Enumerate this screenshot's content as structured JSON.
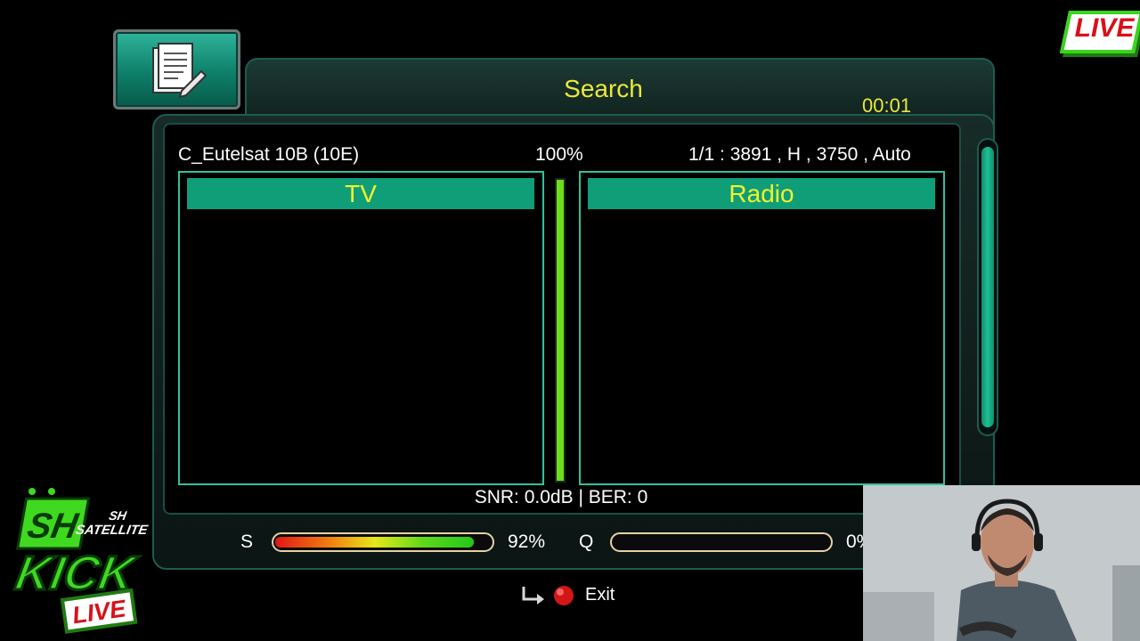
{
  "header": {
    "title": "Search",
    "timer": "00:01"
  },
  "scan": {
    "satellite": "C_Eutelsat 10B (10E)",
    "progress_label": "100%",
    "progress": 1.0,
    "transponder": "1/1 : 3891 , H , 3750 , Auto"
  },
  "lists": {
    "tv_label": "TV",
    "radio_label": "Radio"
  },
  "signal": {
    "snr_ber": "SNR: 0.0dB | BER: 0",
    "strength_label": "S",
    "strength_value": "92%",
    "strength": 0.92,
    "quality_label": "Q",
    "quality_value": "0%",
    "quality": 0.0
  },
  "footer": {
    "exit_label": "Exit"
  },
  "overlays": {
    "live_badge": "LIVE",
    "logo_text": [
      "SH",
      "SATELLITE"
    ],
    "kick_text": "KICK",
    "kick_live": "LIVE"
  },
  "colors": {
    "title_yellow": "#e9e93a",
    "list_header_green": "#0f9e78",
    "list_border": "#2ec29e",
    "progress_green": "#6fdc1e"
  },
  "icons": {
    "menu": "document-edit-icon",
    "exit_arrow": "return-arrow-icon",
    "exit_button": "red-button-icon"
  }
}
